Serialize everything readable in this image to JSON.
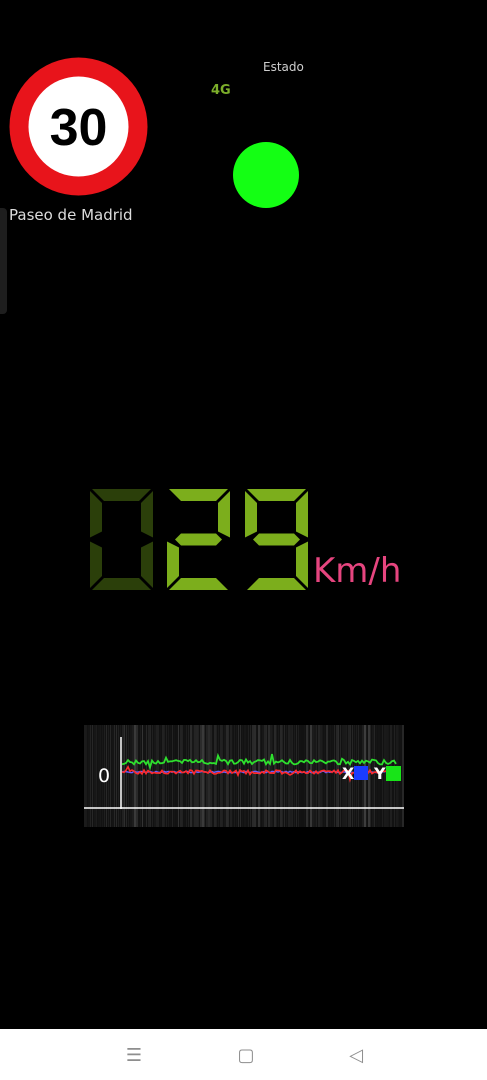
{
  "speed_limit": {
    "value": "30",
    "ring_color": "#e8141b"
  },
  "street_name": "Paseo de Madrid",
  "status": {
    "label": "Estado",
    "network": "4G",
    "indicator_color": "#14ff14"
  },
  "speedometer": {
    "digits": [
      "0",
      "2",
      "9"
    ],
    "unit": "Km/h",
    "lit_color": "#7cae1c",
    "dim_color": "#2b3f0a",
    "unit_color": "#e6457f"
  },
  "accel_graph": {
    "zero_label": "0",
    "x_label": "X",
    "y_label": "Y",
    "x_color": "#1a3cff",
    "y_color": "#18e418",
    "trace_colors": {
      "y": "#2ee02e",
      "x": "#ff2a2a",
      "baseline": "#6a5cff"
    }
  },
  "nav": {
    "menu_icon": "☰",
    "home_icon": "▢",
    "back_icon": "◁"
  }
}
